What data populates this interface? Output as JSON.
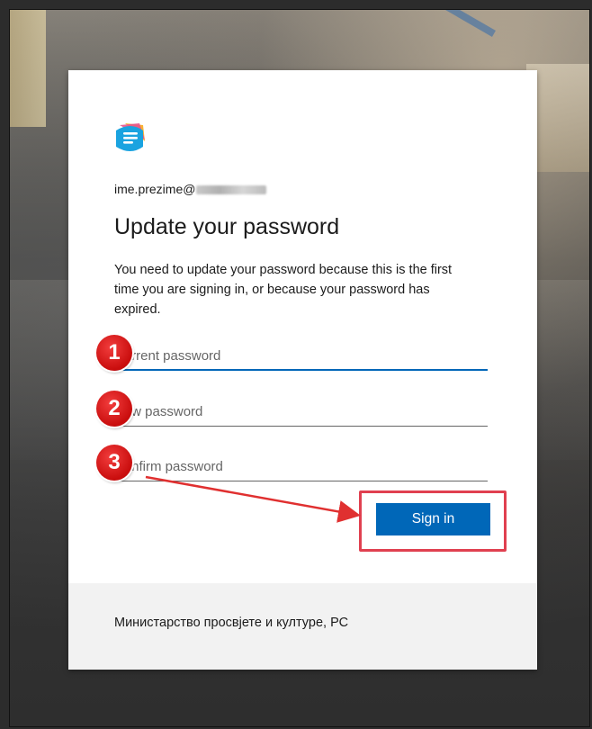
{
  "signin": {
    "email_prefix": "ime.prezime@",
    "title": "Update your password",
    "description": "You need to update your password because this is the first time you are signing in, or because your password has expired.",
    "fields": {
      "current_placeholder": "Current password",
      "new_placeholder": "New password",
      "confirm_placeholder": "Confirm password"
    },
    "submit_label": "Sign in",
    "footer_text": "Министарство просвјете и културе, РС"
  },
  "annotations": {
    "step1": "1",
    "step2": "2",
    "step3": "3"
  },
  "colors": {
    "accent": "#0067b8",
    "marker": "#d51515",
    "highlight": "#e04050"
  }
}
